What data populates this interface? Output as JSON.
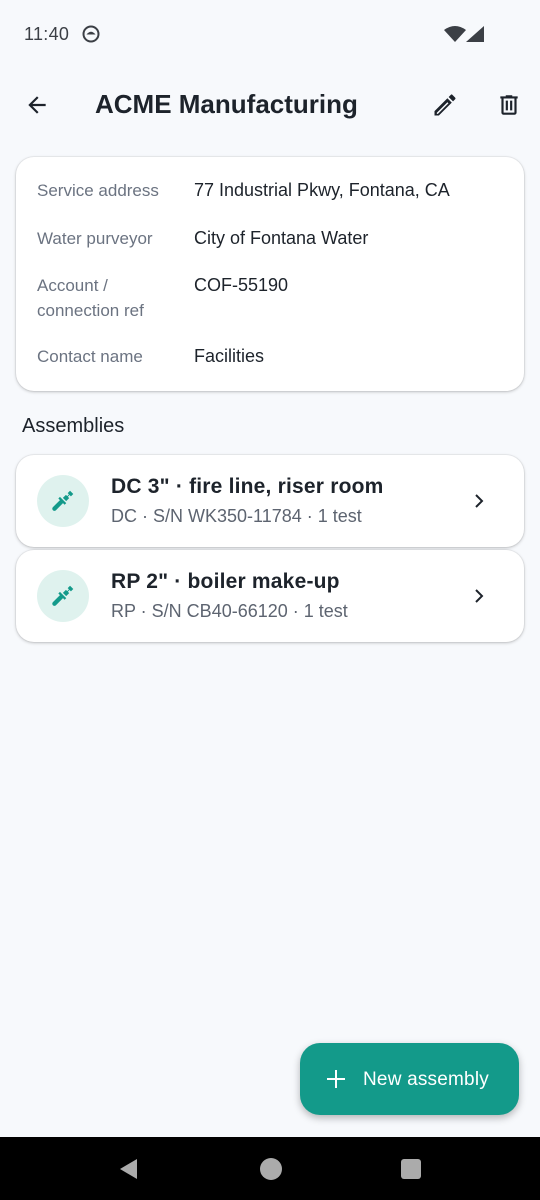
{
  "status_bar": {
    "time": "11:40"
  },
  "app_bar": {
    "title": "ACME Manufacturing",
    "back_icon": "arrow-back-icon",
    "edit_icon": "pencil-icon",
    "delete_icon": "trash-icon"
  },
  "details": [
    {
      "label": "Service address",
      "value": "77 Industrial Pkwy, Fontana, CA"
    },
    {
      "label": "Water purveyor",
      "value": "City of Fontana Water"
    },
    {
      "label": "Account / connection ref",
      "value": "COF-55190"
    },
    {
      "label": "Contact name",
      "value": "Facilities"
    }
  ],
  "assemblies_section": {
    "title": "Assemblies",
    "items": [
      {
        "title": "DC 3\" · fire line, riser room",
        "subtitle": "DC · S/N WK350-11784 · 1 test",
        "icon": "plumbing-wrench-icon"
      },
      {
        "title": "RP 2\" · boiler make-up",
        "subtitle": "RP · S/N CB40-66120 · 1 test",
        "icon": "plumbing-wrench-icon"
      }
    ]
  },
  "fab": {
    "label": "New assembly",
    "icon": "plus-icon"
  },
  "colors": {
    "accent": "#139a8a",
    "accent_light": "#dff2ee",
    "background": "#f7f9fc"
  }
}
